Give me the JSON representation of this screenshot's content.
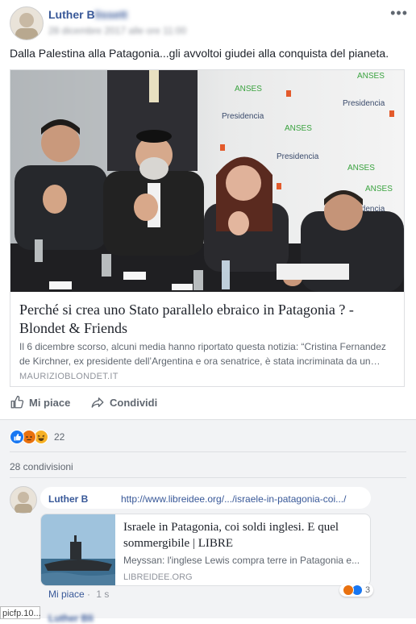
{
  "post": {
    "author_visible": "Luther B",
    "author_hidden": "lissett",
    "meta": "28 dicembre 2017 alle ore 11:00",
    "text": "Dalla Palestina alla Patagonia...gli avvoltoi giudei alla conquista del pianeta.",
    "more_icon": "•••"
  },
  "card": {
    "title": "Perché si crea uno Stato parallelo ebraico in Patagonia ? - Blondet & Friends",
    "description": "Il 6 dicembre scorso, alcuni media hanno riportato questa notizia: “Cristina Fernandez de Kirchner, ex presidente dell’Argentina e ora senatrice, è stata incriminata da un…",
    "domain": "MAURIZIOBLONDET.IT",
    "photo_text": {
      "anses_labels": [
        "ANSES",
        "ANSES",
        "ANSES",
        "ANSES",
        "ANSES"
      ],
      "presidencia_labels": [
        "Presidencia",
        "Presidencia",
        "Presidencia",
        "Presidencia"
      ]
    }
  },
  "actions": {
    "like_label": "Mi piace",
    "share_label": "Condividi"
  },
  "reactions": {
    "count": "22",
    "colors": {
      "like": "#1877f2",
      "angry": "#e9710f",
      "haha": "#f7b125"
    }
  },
  "shares": {
    "label": "28 condivisioni"
  },
  "comment": {
    "author": "Luther B",
    "link_text": "http://www.libreidee.org/.../israele-in-patagonia-coi.../",
    "link_card": {
      "title": "Israele in Patagonia, coi soldi inglesi. E quel sommergibile | LIBRE",
      "description": "Meyssan: l'inglese Lewis compra terre in Patagonia e...",
      "domain": "LIBREIDEE.ORG"
    },
    "like_label": "Mi piace",
    "time": "1 s",
    "reaction_count": "3"
  },
  "tooltip": {
    "text": "picfp.10..."
  },
  "next_comment": {
    "author": "Luther Bli"
  }
}
